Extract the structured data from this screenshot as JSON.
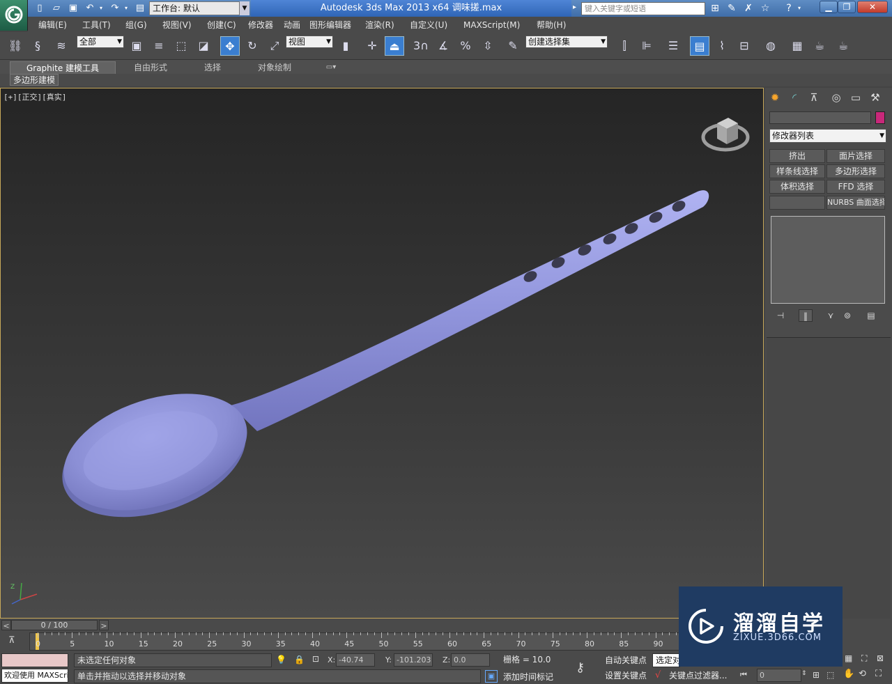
{
  "titlebar": {
    "workspace": "工作台: 默认",
    "title": "Autodesk 3ds Max  2013 x64     调味搓.max",
    "search_placeholder": "键入关键字或短语"
  },
  "menu": [
    "编辑(E)",
    "工具(T)",
    "组(G)",
    "视图(V)",
    "创建(C)",
    "修改器",
    "动画",
    "图形编辑器",
    "渲染(R)",
    "自定义(U)",
    "MAXScript(M)",
    "帮助(H)"
  ],
  "toolbar": {
    "selection_filter": "全部",
    "ref_coord": "视图",
    "named_selection": "创建选择集",
    "snap_3": "3"
  },
  "ribbon": {
    "tabs": [
      "Graphite 建模工具",
      "自由形式",
      "选择",
      "对象绘制"
    ],
    "sub_label": "多边形建模"
  },
  "viewport": {
    "label": "[+][正交][真实]",
    "object_color": "#8f92d8"
  },
  "command_panel": {
    "modifier_list": "修改器列表",
    "buttons": [
      "挤出",
      "面片选择",
      "样条线选择",
      "多边形选择",
      "体积选择",
      "FFD 选择",
      "",
      "NURBS 曲面选择"
    ]
  },
  "timeline": {
    "frame": "0 / 100",
    "ticks": [
      "0",
      "5",
      "10",
      "15",
      "20",
      "25",
      "30",
      "35",
      "40",
      "45",
      "50",
      "55",
      "60",
      "65",
      "70",
      "75",
      "80",
      "85",
      "90"
    ]
  },
  "status": {
    "welcome": "欢迎使用 MAXScri",
    "selection_status": "未选定任何对象",
    "prompt": "单击并拖动以选择并移动对象",
    "x_label": "X:",
    "x": "-40.74",
    "y_label": "Y:",
    "y": "-101.203",
    "z_label": "Z:",
    "z": "0.0",
    "grid": "栅格 = 10.0",
    "add_time_tag": "添加时间标记",
    "auto_key": "自动关键点",
    "set_key": "设置关键点",
    "selected": "选定对",
    "key_filters": "关键点过滤器...",
    "current_frame": "0"
  },
  "watermark": {
    "title": "溜溜自学",
    "url": "ZIXUE.3D66.COM"
  }
}
